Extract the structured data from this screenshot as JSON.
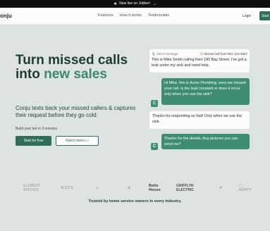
{
  "announcement": {
    "star": "★",
    "text": "New live on Jobber!",
    "arrow": "→"
  },
  "nav": {
    "logo": "onju",
    "links": [
      "Features",
      "How it works",
      "Testimonials"
    ],
    "login": "Login",
    "start": "Start"
  },
  "hero": {
    "title_part1": "Turn missed calls into ",
    "title_highlight": "new sales",
    "subtitle": "Conju texts back your missed callers & captures their request before they go cold.",
    "build_line": "Build your bot in 3 minutes.",
    "primary_button": "Start for free",
    "secondary_button": "Watch demo ▷"
  },
  "conversation": {
    "voice_label": "Voice message",
    "missed_label": "Missed call from 901-123-4567",
    "messages": [
      {
        "from": "caller",
        "text": "This is Mike Smith calling from 182 Bay Street. I've got a leak under my sink and need help."
      },
      {
        "from": "bot",
        "text": "Hi Mike, this is Acme Plumbing, sorry we missed your call. Is the leak constant or does it occur only when you use the sink?"
      },
      {
        "from": "caller",
        "text": "Thanks for responding so fast! Only when we use the sink."
      },
      {
        "from": "bot",
        "text": "Thanks for the details. Any pictures you can send me?"
      }
    ],
    "avatar_letter": "C"
  },
  "logos": [
    "ELEMENT SERVICE",
    "M CO'S",
    "◎",
    "▣",
    "Bello House",
    "GRIFFLYN ELECTRIC",
    "✺",
    "◯ NORTH"
  ],
  "trusted": "Trusted by home service owners in every industry.",
  "colors": {
    "brand_green": "#2f6e58",
    "bubble_green": "#3e8d70",
    "background": "#dde3e1"
  }
}
